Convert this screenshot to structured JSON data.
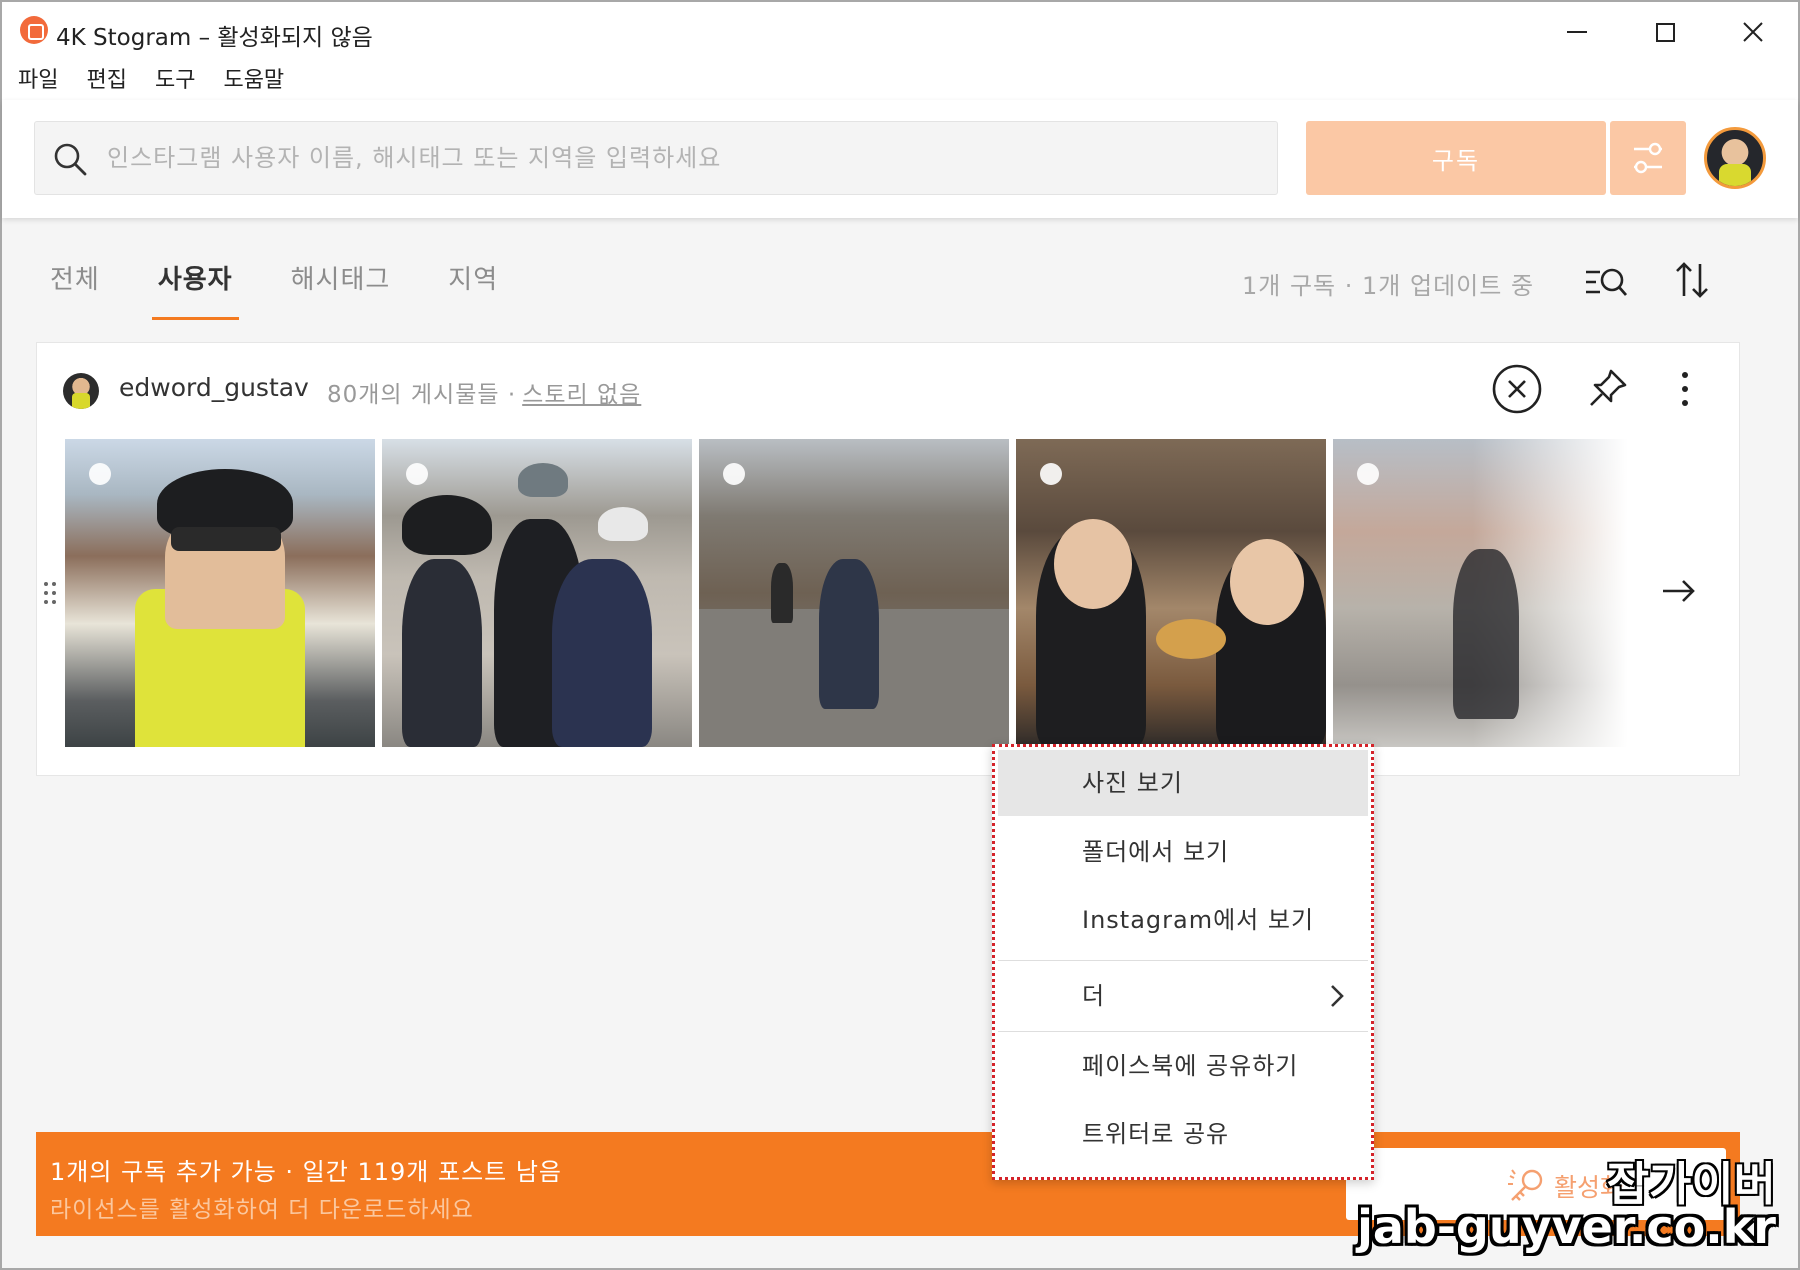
{
  "window": {
    "title": "4K Stogram – 활성화되지 않음",
    "controls": {
      "minimize": "minimize-icon",
      "maximize": "maximize-icon",
      "close": "close-icon"
    }
  },
  "menu": {
    "items": [
      "파일",
      "편집",
      "도구",
      "도움말"
    ]
  },
  "toolbar": {
    "search_placeholder": "인스타그램 사용자 이름, 해시태그 또는 지역을 입력하세요",
    "search_value": "",
    "subscribe_label": "구독",
    "accent_color": "#f47a20",
    "disabled_button_color": "#fbc8a5"
  },
  "tabs": {
    "items": [
      "전체",
      "사용자",
      "해시태그",
      "지역"
    ],
    "active": "사용자"
  },
  "status": {
    "text": "1개 구독 · 1개 업데이트 중"
  },
  "subscription": {
    "username": "edword_gustav",
    "posts": "80개의 게시물들 ·",
    "story": "스토리 없음",
    "thumbnails": [
      "photo-selfie-cyclist",
      "photo-group-cyclists",
      "photo-road-cycling",
      "photo-restaurant",
      "photo-street-cyclist"
    ]
  },
  "context_menu": {
    "view_photo": "사진 보기",
    "view_in_folder": "폴더에서 보기",
    "view_on_instagram": "Instagram에서 보기",
    "more": "더",
    "share_facebook": "페이스북에 공유하기",
    "share_twitter": "트위터로 공유"
  },
  "banner": {
    "line1": "1개의 구독 추가 가능 · 일간 119개 포스트 남음",
    "line2": "라이선스를 활성화하여 더 다운로드하세요",
    "activate_label": "활성화",
    "color": "#f47a20"
  },
  "watermark": {
    "line1": "잡가이버",
    "line2": "jab-guyver.co.kr"
  }
}
